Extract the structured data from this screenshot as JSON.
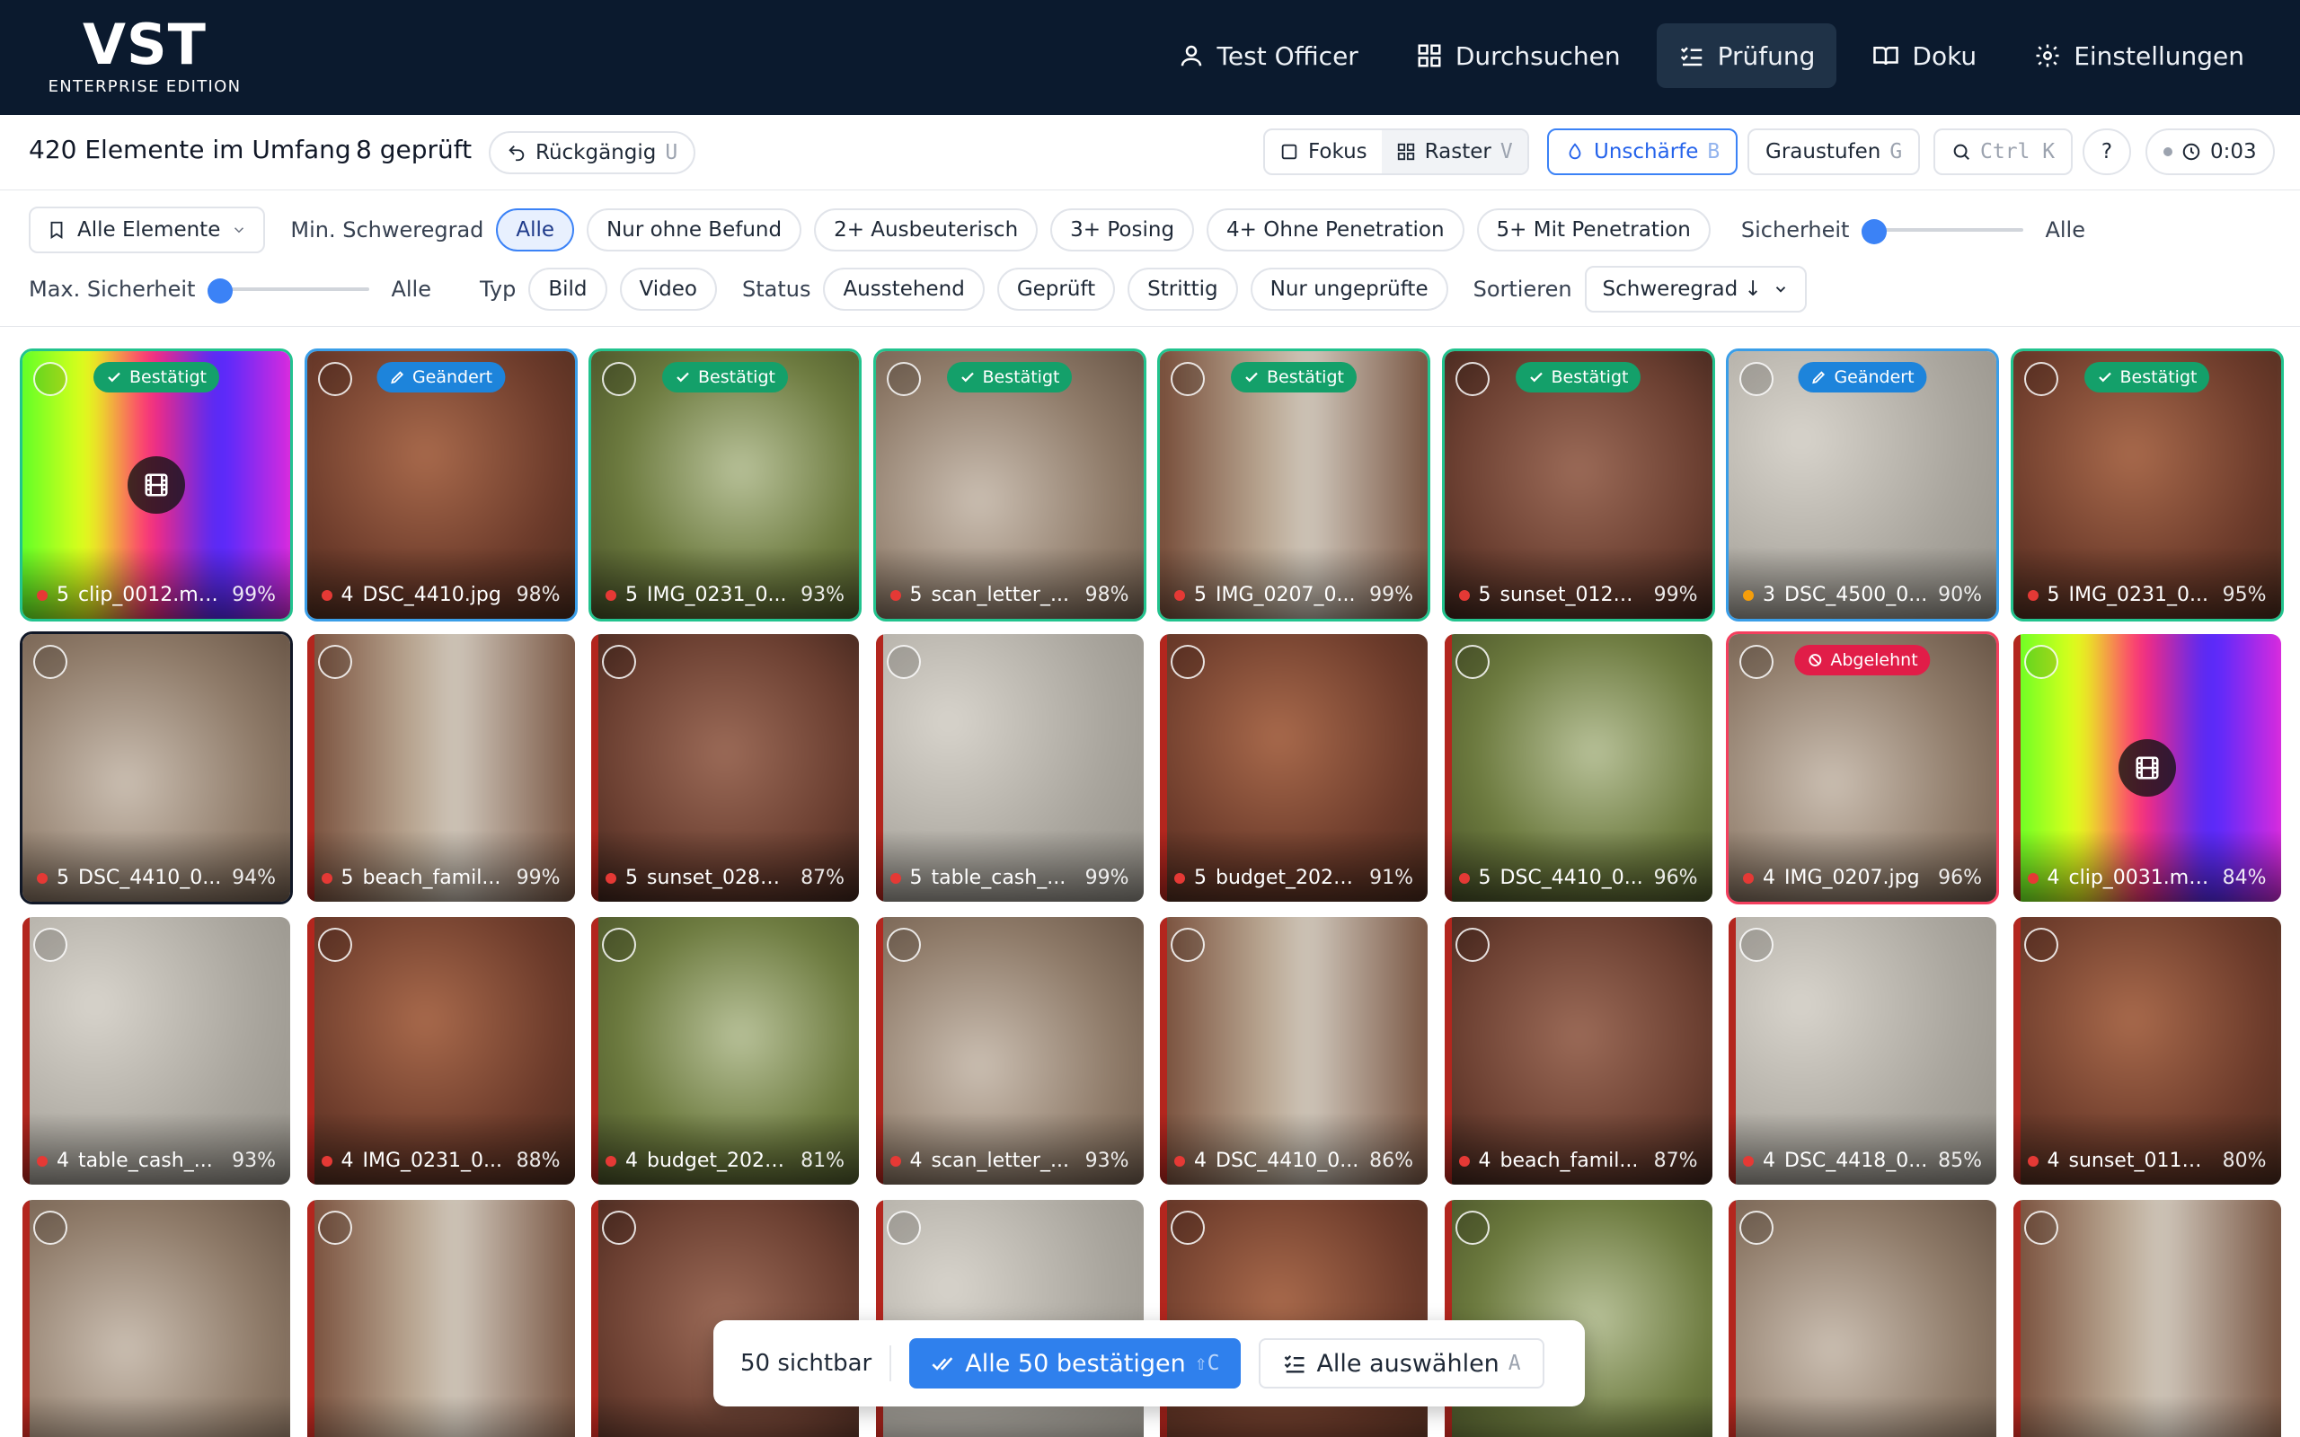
{
  "app": {
    "logo": "VST",
    "edition": "ENTERPRISE EDITION"
  },
  "nav": [
    {
      "label": "Test Officer",
      "icon": "user-icon",
      "active": false
    },
    {
      "label": "Durchsuchen",
      "icon": "grid-icon",
      "active": false
    },
    {
      "label": "Prüfung",
      "icon": "checklist-icon",
      "active": true
    },
    {
      "label": "Doku",
      "icon": "book-icon",
      "active": false
    },
    {
      "label": "Einstellungen",
      "icon": "gear-icon",
      "active": false
    }
  ],
  "status": {
    "count": "420 Elemente im Umfang",
    "checked": "8 geprüft",
    "undo": "Rückgängig",
    "undo_key": "U"
  },
  "view": {
    "focus": "Fokus",
    "grid": "Raster",
    "grid_key": "V",
    "blur": "Unschärfe",
    "blur_key": "B",
    "gray": "Graustufen",
    "gray_key": "G",
    "search_key": "Ctrl K",
    "help": "?",
    "timer": "0:03"
  },
  "filters": {
    "all_items": "Alle Elemente",
    "min_sev_label": "Min. Schweregrad",
    "sev_chips": [
      "Alle",
      "Nur ohne Befund",
      "2+ Ausbeuterisch",
      "3+ Posing",
      "4+ Ohne Penetration",
      "5+ Mit Penetration"
    ],
    "confidence_label": "Sicherheit",
    "confidence_value": "Alle",
    "max_conf_label": "Max. Sicherheit",
    "max_conf_value": "Alle",
    "type_label": "Typ",
    "type_chips": [
      "Bild",
      "Video"
    ],
    "status_label": "Status",
    "status_chips": [
      "Ausstehend",
      "Geprüft",
      "Strittig",
      "Nur ungeprüfte"
    ],
    "sort_label": "Sortieren",
    "sort_value": "Schweregrad ↓"
  },
  "items": [
    {
      "sev": "5",
      "name": "clip_0012.mp4",
      "conf": "99%",
      "badge": "Bestätigt",
      "state": "ok",
      "video": true
    },
    {
      "sev": "4",
      "name": "DSC_4410.jpg",
      "conf": "98%",
      "badge": "Geändert",
      "state": "mod"
    },
    {
      "sev": "5",
      "name": "IMG_0231_0...",
      "conf": "93%",
      "badge": "Bestätigt",
      "state": "ok"
    },
    {
      "sev": "5",
      "name": "scan_letter_...",
      "conf": "98%",
      "badge": "Bestätigt",
      "state": "ok"
    },
    {
      "sev": "5",
      "name": "IMG_0207_0...",
      "conf": "99%",
      "badge": "Bestätigt",
      "state": "ok"
    },
    {
      "sev": "5",
      "name": "sunset_0127....",
      "conf": "99%",
      "badge": "Bestätigt",
      "state": "ok"
    },
    {
      "sev": "3",
      "name": "DSC_4500_0...",
      "conf": "90%",
      "badge": "Geändert",
      "state": "mod"
    },
    {
      "sev": "5",
      "name": "IMG_0231_0...",
      "conf": "95%",
      "badge": "Bestätigt",
      "state": "ok"
    },
    {
      "sev": "5",
      "name": "DSC_4410_0...",
      "conf": "94%",
      "state": "focus"
    },
    {
      "sev": "5",
      "name": "beach_famil...",
      "conf": "99%"
    },
    {
      "sev": "5",
      "name": "sunset_0281....",
      "conf": "87%"
    },
    {
      "sev": "5",
      "name": "table_cash_...",
      "conf": "99%"
    },
    {
      "sev": "5",
      "name": "budget_2025...",
      "conf": "91%"
    },
    {
      "sev": "5",
      "name": "DSC_4410_0...",
      "conf": "96%"
    },
    {
      "sev": "4",
      "name": "IMG_0207.jpg",
      "conf": "96%",
      "badge": "Abgelehnt",
      "state": "rej"
    },
    {
      "sev": "4",
      "name": "clip_0031.mp4",
      "conf": "84%",
      "video": true
    },
    {
      "sev": "4",
      "name": "table_cash_...",
      "conf": "93%"
    },
    {
      "sev": "4",
      "name": "IMG_0231_0...",
      "conf": "88%"
    },
    {
      "sev": "4",
      "name": "budget_2025...",
      "conf": "81%"
    },
    {
      "sev": "4",
      "name": "scan_letter_...",
      "conf": "93%"
    },
    {
      "sev": "4",
      "name": "DSC_4410_0...",
      "conf": "86%"
    },
    {
      "sev": "4",
      "name": "beach_famil...",
      "conf": "87%"
    },
    {
      "sev": "4",
      "name": "DSC_4418_0...",
      "conf": "85%"
    },
    {
      "sev": "4",
      "name": "sunset_0116....",
      "conf": "80%"
    },
    {
      "sev": "",
      "name": "",
      "conf": ""
    },
    {
      "sev": "",
      "name": "",
      "conf": ""
    },
    {
      "sev": "",
      "name": "",
      "conf": ""
    },
    {
      "sev": "",
      "name": "",
      "conf": ""
    },
    {
      "sev": "",
      "name": "",
      "conf": ""
    },
    {
      "sev": "",
      "name": "",
      "conf": ""
    },
    {
      "sev": "",
      "name": "",
      "conf": ""
    },
    {
      "sev": "",
      "name": "",
      "conf": ""
    }
  ],
  "actions": {
    "visible": "50 sichtbar",
    "confirm": "Alle 50 bestätigen",
    "confirm_key": "⇧C",
    "select": "Alle auswählen",
    "select_key": "A"
  },
  "colors": {
    "topbar": "#0b1a2e",
    "accent": "#2f80ed",
    "confirmed": "#14a06a",
    "changed": "#1d84db",
    "rejected": "#e11d48",
    "severity_high": "#e53935",
    "severity_mid": "#f59e0b"
  }
}
